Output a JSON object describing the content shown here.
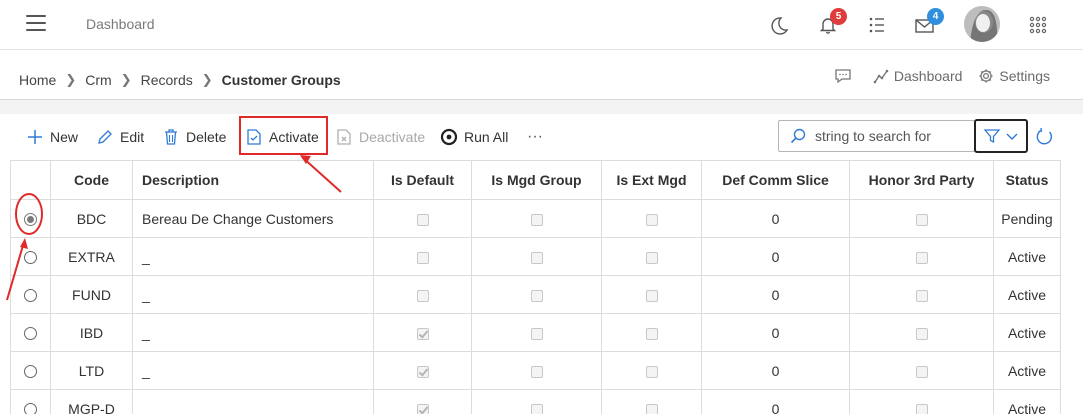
{
  "header": {
    "app_title": "Dashboard",
    "notifications_count": "5",
    "messages_count": "4"
  },
  "breadcrumb": {
    "items": [
      "Home",
      "Crm",
      "Records"
    ],
    "current": "Customer Groups",
    "actions": {
      "dashboard": "Dashboard",
      "settings": "Settings"
    }
  },
  "toolbar": {
    "new": "New",
    "edit": "Edit",
    "delete": "Delete",
    "activate": "Activate",
    "deactivate": "Deactivate",
    "run_all": "Run All",
    "more": "···",
    "search_placeholder": "string to search for"
  },
  "table": {
    "columns": [
      "",
      "Code",
      "Description",
      "Is Default",
      "Is Mgd Group",
      "Is Ext Mgd",
      "Def Comm Slice",
      "Honor 3rd Party",
      "Status"
    ],
    "rows": [
      {
        "selected": true,
        "code": "BDC",
        "description": "Bereau De Change Customers",
        "is_default": false,
        "is_mgd_group": false,
        "is_ext_mgd": false,
        "def_comm_slice": "0",
        "honor_3rd_party": false,
        "status": "Pending"
      },
      {
        "selected": false,
        "code": "EXTRA",
        "description": "_",
        "is_default": false,
        "is_mgd_group": false,
        "is_ext_mgd": false,
        "def_comm_slice": "0",
        "honor_3rd_party": false,
        "status": "Active"
      },
      {
        "selected": false,
        "code": "FUND",
        "description": "_",
        "is_default": false,
        "is_mgd_group": false,
        "is_ext_mgd": false,
        "def_comm_slice": "0",
        "honor_3rd_party": false,
        "status": "Active"
      },
      {
        "selected": false,
        "code": "IBD",
        "description": "_",
        "is_default": true,
        "is_mgd_group": false,
        "is_ext_mgd": false,
        "def_comm_slice": "0",
        "honor_3rd_party": false,
        "status": "Active"
      },
      {
        "selected": false,
        "code": "LTD",
        "description": "_",
        "is_default": true,
        "is_mgd_group": false,
        "is_ext_mgd": false,
        "def_comm_slice": "0",
        "honor_3rd_party": false,
        "status": "Active"
      },
      {
        "selected": false,
        "code": "MGP-D",
        "description": "",
        "is_default": true,
        "is_mgd_group": false,
        "is_ext_mgd": false,
        "def_comm_slice": "0",
        "honor_3rd_party": false,
        "status": "Active"
      }
    ]
  },
  "colors": {
    "annotation_red": "#e02a2a",
    "badge_red": "#e03c3c",
    "badge_blue": "#2f8fdc",
    "accent_blue": "#2f7bd6"
  }
}
